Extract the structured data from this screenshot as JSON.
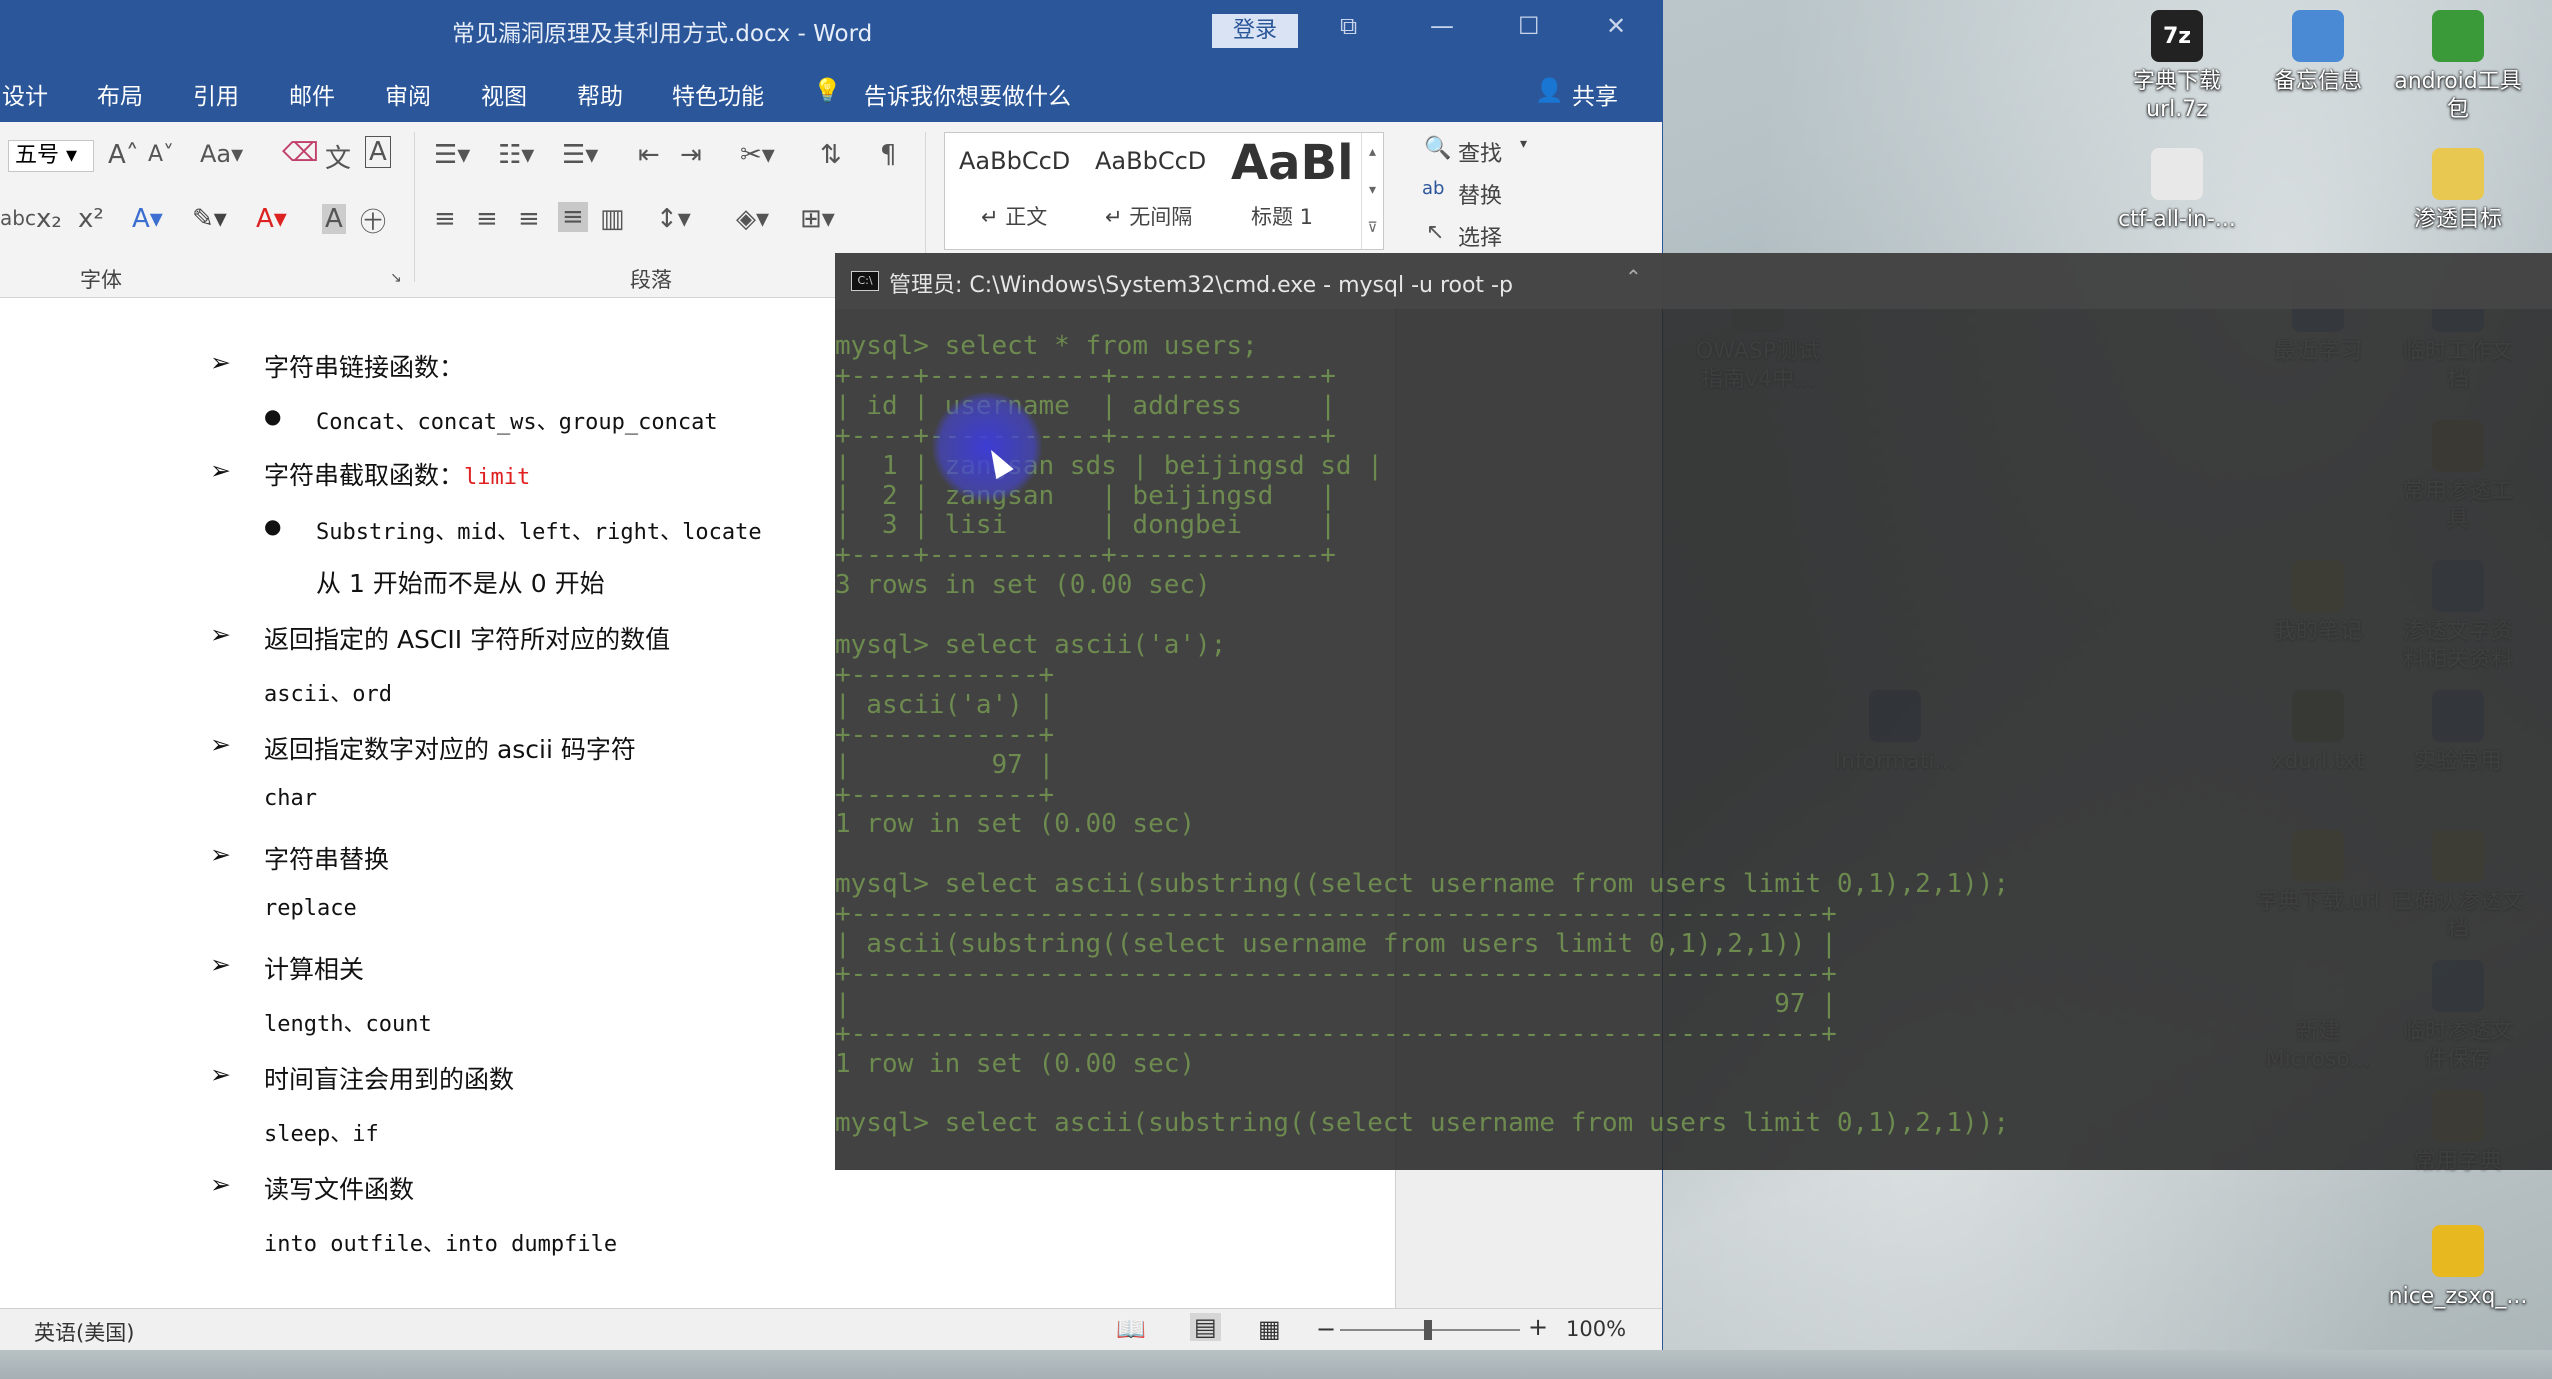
{
  "word": {
    "title": "常见漏洞原理及其利用方式.docx  -  Word",
    "login": "登录",
    "menu": [
      "设计",
      "布局",
      "引用",
      "邮件",
      "审阅",
      "视图",
      "帮助",
      "特色功能",
      "告诉我你想要做什么"
    ],
    "share": "共享",
    "font_size": "五号",
    "font_group": "字体",
    "paragraph_group": "段落",
    "styles": [
      {
        "preview": "AaBbCcD",
        "name": "正文"
      },
      {
        "preview": "AaBbCcD",
        "name": "无间隔"
      },
      {
        "preview": "AaBl",
        "name": "标题 1"
      }
    ],
    "edit": {
      "find": "查找",
      "replace": "替换",
      "select": "选择"
    },
    "status_lang": "英语(美国)",
    "zoom": "100%"
  },
  "doc": {
    "items": [
      {
        "type": "arrow",
        "text": "字符串链接函数："
      },
      {
        "type": "dot",
        "text": "Concat、concat_ws、group_concat"
      },
      {
        "type": "arrow",
        "text": "字符串截取函数：",
        "red": "limit"
      },
      {
        "type": "dot",
        "text": "Substring、mid、left、right、locate"
      },
      {
        "type": "plain",
        "text": "从 1 开始而不是从 0 开始"
      },
      {
        "type": "arrow",
        "text": "返回指定的 ASCII 字符所对应的数值"
      },
      {
        "type": "mono",
        "text": "ascii、ord"
      },
      {
        "type": "arrow",
        "text": "返回指定数字对应的 ascii 码字符"
      },
      {
        "type": "mono",
        "text": "char"
      },
      {
        "type": "arrow",
        "text": "字符串替换"
      },
      {
        "type": "mono",
        "text": "replace"
      },
      {
        "type": "arrow",
        "text": "计算相关"
      },
      {
        "type": "mono",
        "text": "length、count"
      },
      {
        "type": "arrow",
        "text": "时间盲注会用到的函数"
      },
      {
        "type": "mono",
        "text": "sleep、if"
      },
      {
        "type": "arrow",
        "text": "读写文件函数"
      },
      {
        "type": "mono",
        "text": "into outfile、into dumpfile"
      }
    ]
  },
  "cmd": {
    "title": "管理员: C:\\Windows\\System32\\cmd.exe - mysql  -u root -p",
    "lines": [
      "mysql> select * from users;",
      "+----+-----------+-------------+",
      "| id | username  | address     |",
      "+----+-----------+-------------+",
      "|  1 | zangsan sds | beijingsd sd |",
      "|  2 | zangsan   | beijingsd   |",
      "|  3 | lisi      | dongbei     |",
      "+----+-----------+-------------+",
      "3 rows in set (0.00 sec)",
      "",
      "mysql> select ascii('a');",
      "+------------+",
      "| ascii('a') |",
      "+------------+",
      "|         97 |",
      "+------------+",
      "1 row in set (0.00 sec)",
      "",
      "mysql> select ascii(substring((select username from users limit 0,1),2,1));",
      "+--------------------------------------------------------------+",
      "| ascii(substring((select username from users limit 0,1),2,1)) |",
      "+--------------------------------------------------------------+",
      "|                                                           97 |",
      "+--------------------------------------------------------------+",
      "1 row in set (0.00 sec)",
      "",
      "mysql> select ascii(substring((select username from users limit 0,1),2,1));"
    ]
  },
  "desktop": [
    {
      "label": "字典下载\nurl.7z",
      "icon": "7z-archive-icon",
      "color": "#222"
    },
    {
      "label": "备忘信息",
      "icon": "notepad-icon",
      "color": "#4a8ad4"
    },
    {
      "label": "android工具\n包",
      "icon": "chrome-icon",
      "color": "#3a9a3a"
    },
    {
      "label": "ctf-all-in-...",
      "icon": "document-icon",
      "color": "#e8e8e8"
    },
    {
      "label": "渗透目标",
      "icon": "folder-icon",
      "color": "#e8c850"
    },
    {
      "label": "OWASP测试\n指南v4中...",
      "icon": "pdf-icon",
      "color": "#999"
    },
    {
      "label": "最近学习",
      "icon": "computer-icon",
      "color": "#4a8ad4"
    },
    {
      "label": "临时工作文\n档",
      "icon": "computer-icon",
      "color": "#4a8ad4"
    },
    {
      "label": "常用渗透工\n具",
      "icon": "folder-icon",
      "color": "#c8a040"
    },
    {
      "label": "我的笔记",
      "icon": "folder-icon",
      "color": "#e8c850"
    },
    {
      "label": "渗透文字资\n料相关资料",
      "icon": "computer-icon",
      "color": "#4a8ad4"
    },
    {
      "label": "Informati...",
      "icon": "word-icon",
      "color": "#2b579a"
    },
    {
      "label": "xdurl.txt",
      "icon": "text-file-icon",
      "color": "#6a9a3a"
    },
    {
      "label": "实验常用",
      "icon": "chrome-icon",
      "color": "#3a7ac4"
    },
    {
      "label": "字典下载.url",
      "icon": "url-icon",
      "color": "#e8c850"
    },
    {
      "label": "已确认渗透文\n档",
      "icon": "folder-icon",
      "color": "#e8c850"
    },
    {
      "label": "新建\nMicroso...",
      "icon": "document-icon",
      "color": "#ddd"
    },
    {
      "label": "临时渗透文\n件保存",
      "icon": "computer-icon",
      "color": "#4a8ad4"
    },
    {
      "label": "常用字典",
      "icon": "folder-icon",
      "color": "#e8c850"
    },
    {
      "label": "nice_zsxq_...",
      "icon": "app-icon",
      "color": "#e8b820"
    }
  ]
}
